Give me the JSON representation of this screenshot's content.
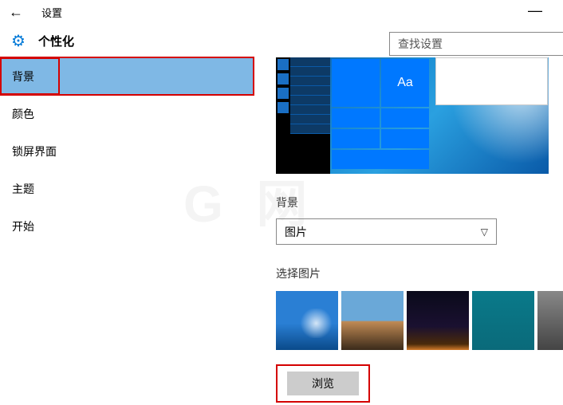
{
  "window": {
    "title": "设置",
    "minimize": "—"
  },
  "header": {
    "section_title": "个性化",
    "gear_icon": "⚙"
  },
  "search": {
    "placeholder": "查找设置"
  },
  "sidebar": {
    "items": [
      {
        "label": "背景",
        "active": true
      },
      {
        "label": "颜色",
        "active": false
      },
      {
        "label": "锁屏界面",
        "active": false
      },
      {
        "label": "主题",
        "active": false
      },
      {
        "label": "开始",
        "active": false
      }
    ]
  },
  "content": {
    "preview_tile_text": "Aa",
    "background_label": "背景",
    "background_dropdown": {
      "selected": "图片"
    },
    "choose_picture_label": "选择图片",
    "browse_button": "浏览"
  },
  "colors": {
    "accent": "#0078d7",
    "sidebar_active": "#7fb8e5",
    "highlight_border": "#d40000"
  }
}
